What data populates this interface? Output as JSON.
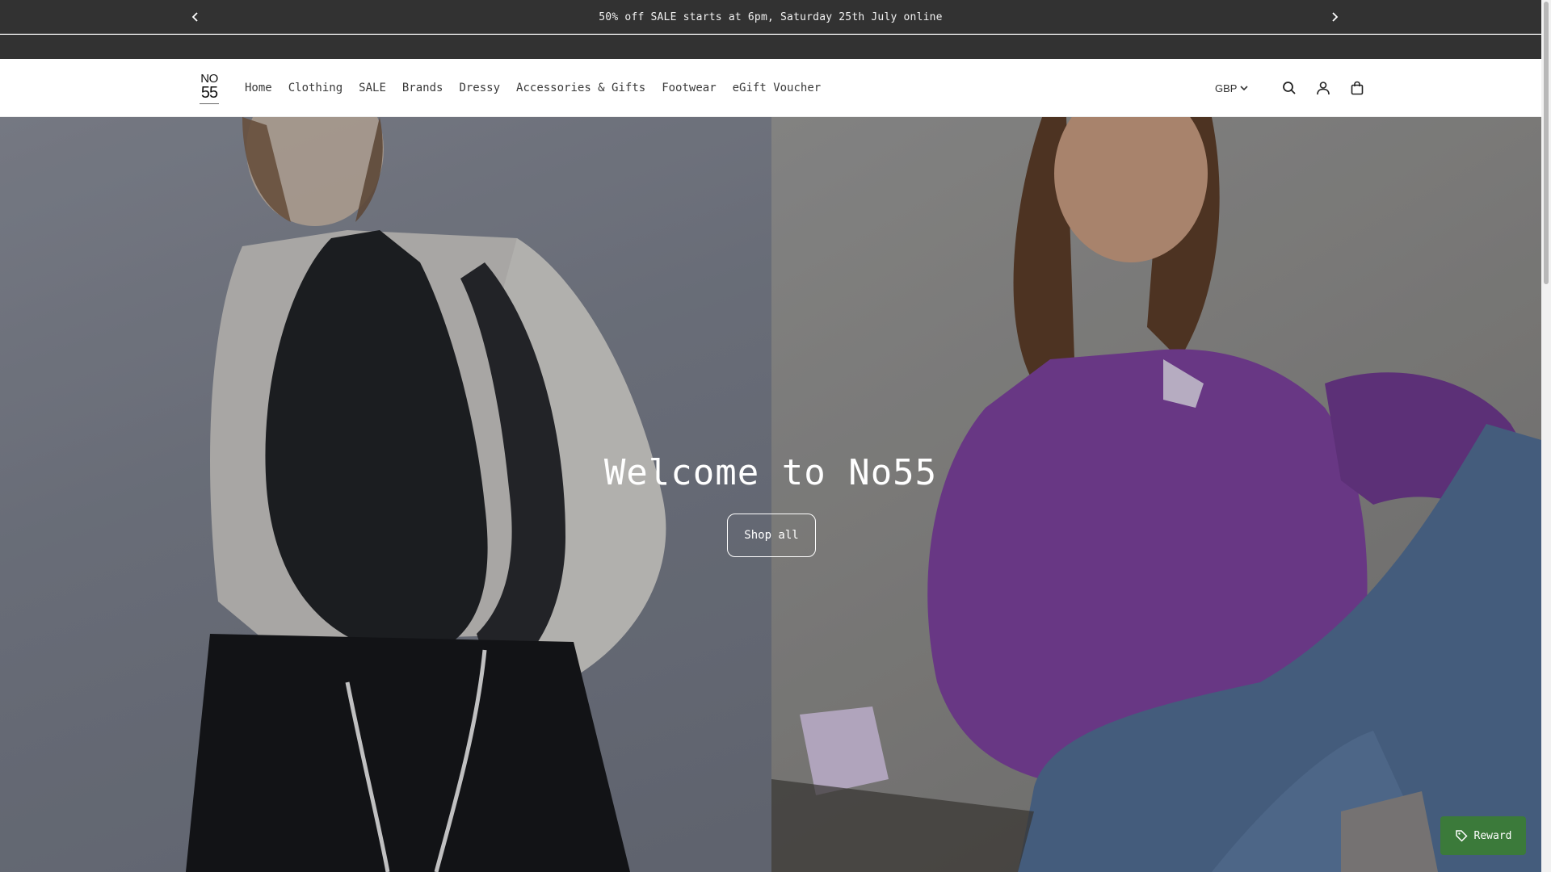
{
  "announcement": {
    "text": "50% off SALE starts at 6pm, Saturday 25th July online",
    "prev_icon": "chevron-left-icon",
    "next_icon": "chevron-right-icon"
  },
  "header": {
    "logo": {
      "line1": "NO",
      "line2": "55"
    },
    "nav": [
      "Home",
      "Clothing",
      "SALE",
      "Brands",
      "Dressy",
      "Accessories & Gifts",
      "Footwear",
      "eGift Voucher"
    ],
    "currency": "GBP",
    "icons": [
      "search-icon",
      "account-icon",
      "bag-icon"
    ]
  },
  "hero": {
    "title": "Welcome to No55",
    "button_label": "Shop all"
  },
  "reward": {
    "label": "Reward",
    "icon": "tag-icon",
    "color": "#3b7a3a"
  },
  "colors": {
    "announcement_bg": "#323232",
    "header_bg": "#ffffff",
    "sweater": "#7a3f9c",
    "jeans": "#4f6c92"
  }
}
